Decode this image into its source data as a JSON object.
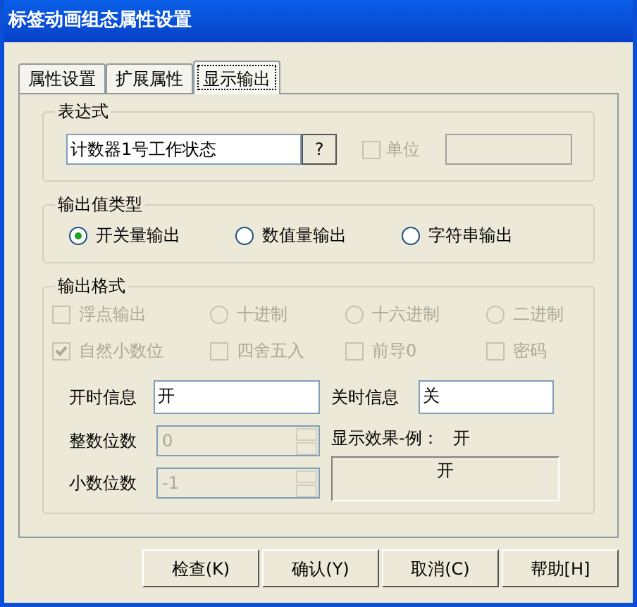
{
  "window": {
    "title": "标签动画组态属性设置"
  },
  "tabs": [
    {
      "label": "属性设置",
      "selected": false
    },
    {
      "label": "扩展属性",
      "selected": false
    },
    {
      "label": "显示输出",
      "selected": true
    }
  ],
  "expression": {
    "legend": "表达式",
    "value": "计数器1号工作状态",
    "help_button": "?",
    "unit": {
      "label": "单位",
      "checked": false,
      "disabled": true
    }
  },
  "output_type": {
    "legend": "输出值类型",
    "options": [
      {
        "label": "开关量输出",
        "selected": true
      },
      {
        "label": "数值量输出",
        "selected": false
      },
      {
        "label": "字符串输出",
        "selected": false
      }
    ]
  },
  "output_format": {
    "legend": "输出格式",
    "options": [
      {
        "kind": "checkbox",
        "label": "浮点输出",
        "checked": false,
        "disabled": true
      },
      {
        "kind": "radio",
        "label": "十进制",
        "selected": false,
        "disabled": true
      },
      {
        "kind": "radio",
        "label": "十六进制",
        "selected": false,
        "disabled": true
      },
      {
        "kind": "radio",
        "label": "二进制",
        "selected": false,
        "disabled": true
      },
      {
        "kind": "checkbox",
        "label": "自然小数位",
        "checked": true,
        "disabled": true
      },
      {
        "kind": "checkbox",
        "label": "四舍五入",
        "checked": false,
        "disabled": true
      },
      {
        "kind": "checkbox",
        "label": "前导0",
        "checked": false,
        "disabled": true
      },
      {
        "kind": "checkbox",
        "label": "密码",
        "checked": false,
        "disabled": true
      }
    ],
    "on_label": "开时信息",
    "on_value": "开",
    "off_label": "关时信息",
    "off_value": "关",
    "integer_digits": {
      "label": "整数位数",
      "value": "0",
      "disabled": true
    },
    "decimal_digits": {
      "label": "小数位数",
      "value": "-1",
      "disabled": true
    },
    "preview_label": "显示效果-例：",
    "preview_sample": "开",
    "preview_box": "开"
  },
  "buttons": [
    "检查(K)",
    "确认(Y)",
    "取消(C)",
    "帮助[H]"
  ]
}
